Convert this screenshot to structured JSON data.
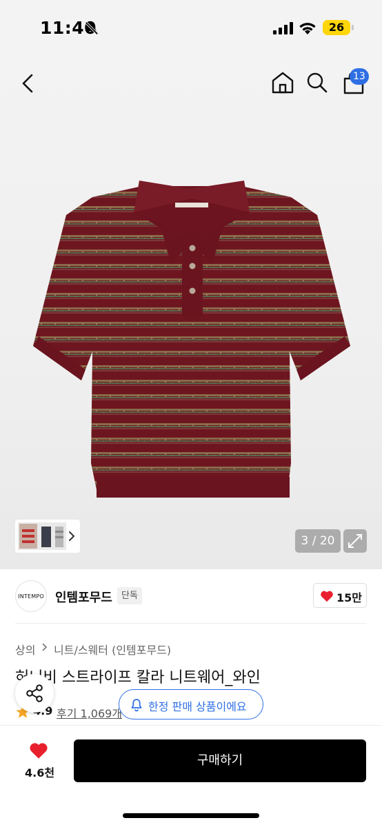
{
  "status_bar": {
    "time": "11:40",
    "battery": "26"
  },
  "header": {
    "cart_count": "13"
  },
  "gallery": {
    "counter": "3 / 20"
  },
  "brand": {
    "logo_text": "INTEMPO",
    "name": "인템포무드",
    "tag": "단독",
    "likes": "15만"
  },
  "breadcrumb": {
    "level1": "상의",
    "level2": "니트/스웨터 (인템포무드)"
  },
  "product": {
    "title": "허니비 스트라이프 칼라 니트웨어_와인",
    "rating": "4.9",
    "reviews": "후기 1,069개"
  },
  "notice": {
    "limited": "한정 판매 상품이에요"
  },
  "footer": {
    "like_count": "4.6천",
    "buy_label": "구매하기"
  },
  "colors": {
    "accent": "#2f6fe4",
    "heart": "#e8202e",
    "knit": "#6e1620",
    "buy_button": "#000000"
  }
}
